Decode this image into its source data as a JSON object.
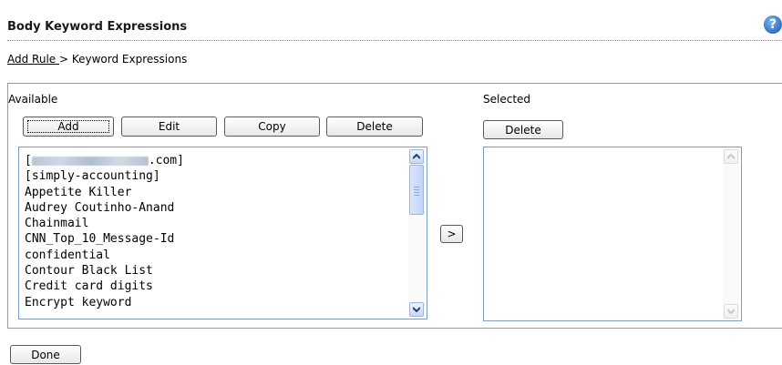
{
  "header": {
    "title": "Body Keyword Expressions",
    "help_icon": "?"
  },
  "breadcrumb": {
    "link": "Add Rule ",
    "current": " > Keyword Expressions"
  },
  "available": {
    "label": "Available",
    "buttons": {
      "add": "Add",
      "edit": "Edit",
      "copy": "Copy",
      "delete": "Delete"
    },
    "items": [
      {
        "prefix": "[",
        "suffix": ".com]"
      },
      {
        "text": "[simply-accounting]"
      },
      {
        "text": "Appetite Killer"
      },
      {
        "text": "Audrey Coutinho-Anand"
      },
      {
        "text": "Chainmail"
      },
      {
        "text": "CNN_Top_10_Message-Id"
      },
      {
        "text": "confidential"
      },
      {
        "text": "Contour Black List"
      },
      {
        "text": "Credit card digits"
      },
      {
        "text": "Encrypt keyword"
      }
    ]
  },
  "move_button": ">",
  "selected": {
    "label": "Selected",
    "buttons": {
      "delete": "Delete"
    }
  },
  "done_button": "Done"
}
